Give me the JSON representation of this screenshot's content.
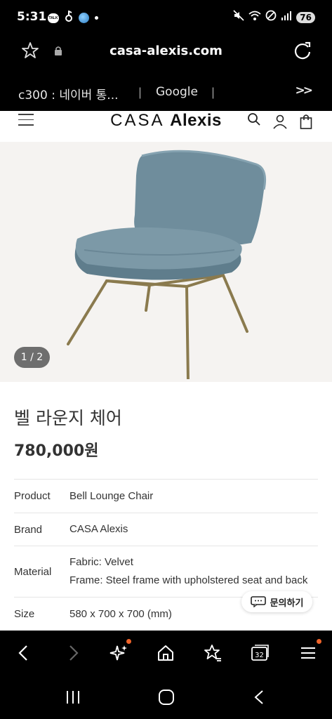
{
  "status_bar": {
    "time": "5:31",
    "talk_badge": "TALK",
    "battery": "76"
  },
  "browser": {
    "url": "casa-alexis.com",
    "bookmarks": [
      "c300 : 네이버 통...",
      "Google"
    ],
    "more": ">>",
    "tab_count": "32"
  },
  "site": {
    "logo_thin": "CASA",
    "logo_bold": "Alexis"
  },
  "product": {
    "image_counter": "1 / 2",
    "title": "벨 라운지 체어",
    "price": "780,000원",
    "image_colors": {
      "upholstery": "#6f8d9c",
      "frame": "#8a7a4e",
      "background": "#f5f3f1"
    }
  },
  "specs": [
    {
      "key": "Product",
      "values": [
        "Bell Lounge Chair"
      ]
    },
    {
      "key": "Brand",
      "values": [
        "CASA Alexis"
      ]
    },
    {
      "key": "Material",
      "values": [
        "Fabric: Velvet",
        "Frame: Steel frame with upholstered seat and back"
      ]
    },
    {
      "key": "Size",
      "values": [
        "580 x 700 x 700 (mm)"
      ]
    }
  ],
  "chat_button": "문의하기",
  "colors": {
    "notification_dot": "#f0642a"
  }
}
